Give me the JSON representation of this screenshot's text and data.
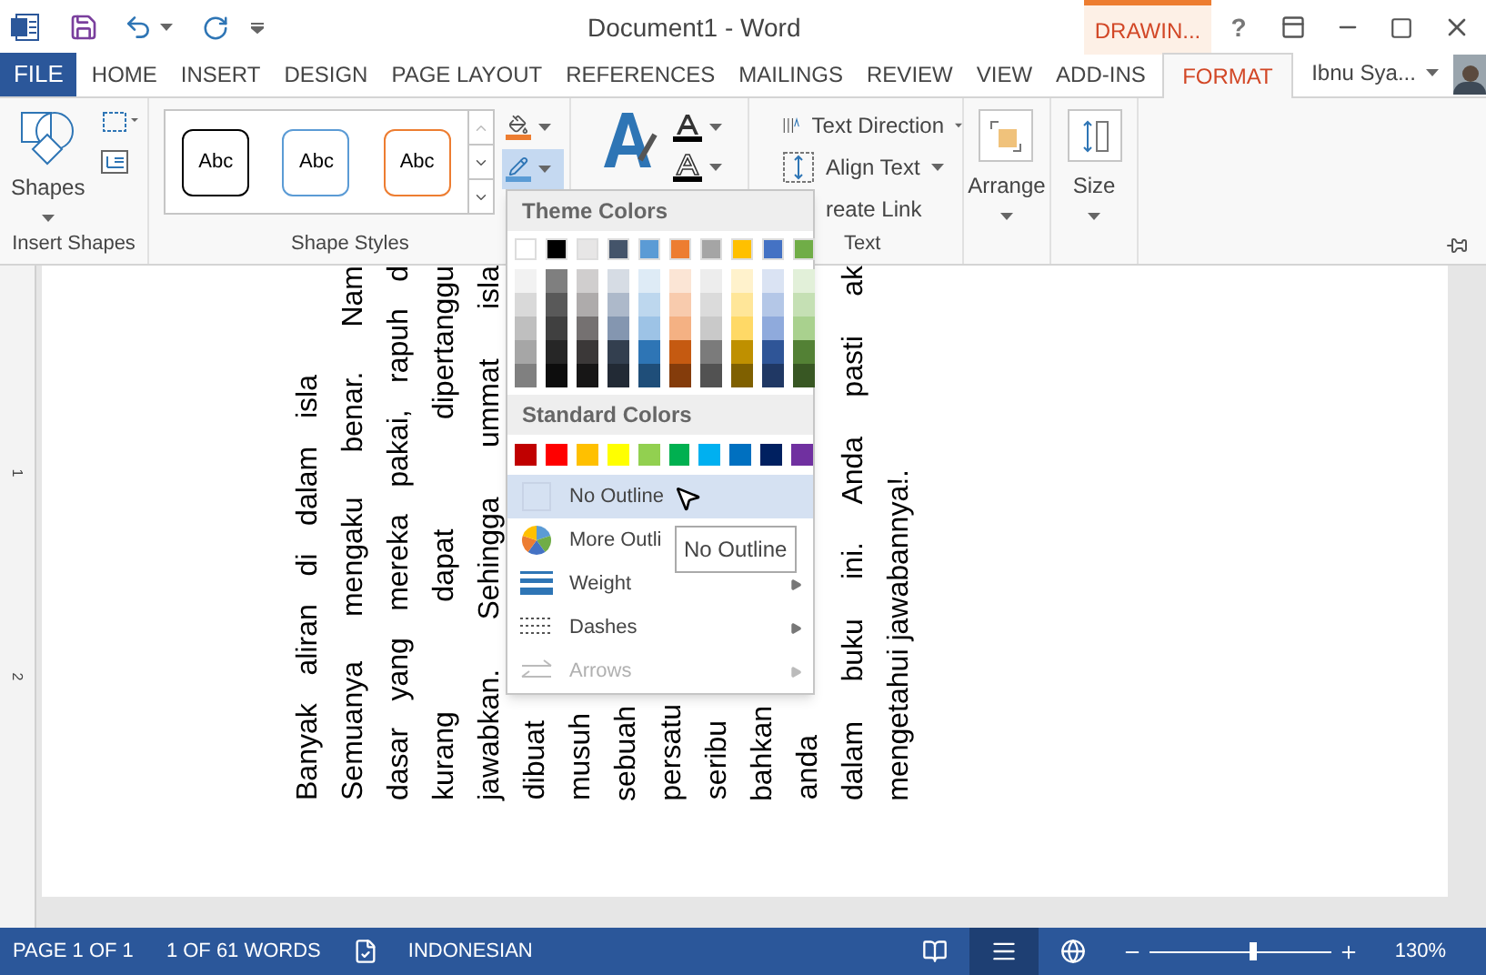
{
  "title_bar": {
    "title": "Document1 - Word",
    "contextual_tab": "DRAWIN...",
    "help": "?"
  },
  "tabs": [
    {
      "label": "FILE",
      "kind": "file",
      "selected": false
    },
    {
      "label": "HOME",
      "kind": "normal",
      "selected": false
    },
    {
      "label": "INSERT",
      "kind": "normal",
      "selected": false
    },
    {
      "label": "DESIGN",
      "kind": "normal",
      "selected": false
    },
    {
      "label": "PAGE LAYOUT",
      "kind": "normal",
      "selected": false
    },
    {
      "label": "REFERENCES",
      "kind": "normal",
      "selected": false
    },
    {
      "label": "MAILINGS",
      "kind": "normal",
      "selected": false
    },
    {
      "label": "REVIEW",
      "kind": "normal",
      "selected": false
    },
    {
      "label": "VIEW",
      "kind": "normal",
      "selected": false
    },
    {
      "label": "ADD-INS",
      "kind": "normal",
      "selected": false
    },
    {
      "label": "FORMAT",
      "kind": "contextual",
      "selected": true
    }
  ],
  "user": {
    "name": "Ibnu Sya..."
  },
  "ribbon": {
    "insert_shapes": {
      "shapes_label": "Shapes",
      "group_label": "Insert Shapes"
    },
    "shape_styles": {
      "styles": [
        {
          "label": "Abc",
          "color": "#000000"
        },
        {
          "label": "Abc",
          "color": "#5b9bd5"
        },
        {
          "label": "Abc",
          "color": "#ed7d31"
        }
      ],
      "outline_pressed": true,
      "group_label": "Shape Styles"
    },
    "text_group": {
      "items": [
        {
          "label": "Text Direction",
          "kind": "direction",
          "dropdown": true
        },
        {
          "label": "Align Text",
          "kind": "align",
          "dropdown": true
        },
        {
          "label": "reate Link",
          "kind": "link",
          "dropdown": false
        }
      ],
      "group_label": "Text"
    },
    "arrange": {
      "label": "Arrange"
    },
    "size": {
      "label": "Size"
    }
  },
  "outline_menu": {
    "theme_header": "Theme Colors",
    "theme_colors": [
      {
        "color": "#ffffff",
        "shades": [
          {
            "color": "#f2f2f2"
          },
          {
            "color": "#d9d9d9"
          },
          {
            "color": "#bfbfbf"
          },
          {
            "color": "#a6a6a6"
          },
          {
            "color": "#808080"
          }
        ]
      },
      {
        "color": "#000000",
        "shades": [
          {
            "color": "#7f7f7f"
          },
          {
            "color": "#595959"
          },
          {
            "color": "#404040"
          },
          {
            "color": "#262626"
          },
          {
            "color": "#0d0d0d"
          }
        ]
      },
      {
        "color": "#e7e6e6",
        "shades": [
          {
            "color": "#d0cece"
          },
          {
            "color": "#aeabab"
          },
          {
            "color": "#757171"
          },
          {
            "color": "#3b3838"
          },
          {
            "color": "#171616"
          }
        ]
      },
      {
        "color": "#44546a",
        "shades": [
          {
            "color": "#d6dce4"
          },
          {
            "color": "#adb9ca"
          },
          {
            "color": "#8496b0"
          },
          {
            "color": "#333f4f"
          },
          {
            "color": "#222a35"
          }
        ]
      },
      {
        "color": "#5b9bd5",
        "shades": [
          {
            "color": "#deebf6"
          },
          {
            "color": "#bdd7ee"
          },
          {
            "color": "#9dc3e6"
          },
          {
            "color": "#2e75b5"
          },
          {
            "color": "#1f4e79"
          }
        ]
      },
      {
        "color": "#ed7d31",
        "shades": [
          {
            "color": "#fbe5d5"
          },
          {
            "color": "#f8cbad"
          },
          {
            "color": "#f4b183"
          },
          {
            "color": "#c55a11"
          },
          {
            "color": "#843c0b"
          }
        ]
      },
      {
        "color": "#a5a5a5",
        "shades": [
          {
            "color": "#ededed"
          },
          {
            "color": "#dbdbdb"
          },
          {
            "color": "#c9c9c9"
          },
          {
            "color": "#7b7b7b"
          },
          {
            "color": "#525252"
          }
        ]
      },
      {
        "color": "#ffc000",
        "shades": [
          {
            "color": "#fff2cc"
          },
          {
            "color": "#ffe699"
          },
          {
            "color": "#ffd966"
          },
          {
            "color": "#bf9000"
          },
          {
            "color": "#7f6000"
          }
        ]
      },
      {
        "color": "#4472c4",
        "shades": [
          {
            "color": "#dae3f3"
          },
          {
            "color": "#b4c7e7"
          },
          {
            "color": "#8faadc"
          },
          {
            "color": "#2f5597"
          },
          {
            "color": "#203864"
          }
        ]
      },
      {
        "color": "#70ad47",
        "shades": [
          {
            "color": "#e2f0d9"
          },
          {
            "color": "#c5e0b4"
          },
          {
            "color": "#a9d18e"
          },
          {
            "color": "#538135"
          },
          {
            "color": "#385723"
          }
        ]
      }
    ],
    "standard_header": "Standard Colors",
    "standard_colors": [
      {
        "color": "#c00000"
      },
      {
        "color": "#ff0000"
      },
      {
        "color": "#ffc000"
      },
      {
        "color": "#ffff00"
      },
      {
        "color": "#92d050"
      },
      {
        "color": "#00b050"
      },
      {
        "color": "#00b0f0"
      },
      {
        "color": "#0070c0"
      },
      {
        "color": "#002060"
      },
      {
        "color": "#7030a0"
      }
    ],
    "items": [
      {
        "label": "No Outline",
        "kind": "none",
        "selected": true,
        "disabled": false,
        "submenu": false
      },
      {
        "label": "More Outli",
        "kind": "palette",
        "selected": false,
        "disabled": false,
        "submenu": false
      },
      {
        "label": "Weight",
        "kind": "weight",
        "selected": false,
        "disabled": false,
        "submenu": true
      },
      {
        "label": "Dashes",
        "kind": "dashes",
        "selected": false,
        "disabled": false,
        "submenu": true
      },
      {
        "label": "Arrows",
        "kind": "arrows",
        "selected": false,
        "disabled": true,
        "submenu": true
      }
    ]
  },
  "tooltip": "No Outline",
  "document": {
    "ruler_marks": [
      "1",
      "2"
    ],
    "columns": [
      {
        "text": "Banyak aliran di dalam isla",
        "kind": "justified"
      },
      {
        "text": "Semuanya mengaku benar. Nam",
        "kind": "justified"
      },
      {
        "text": "dasar yang mereka pakai, rapuh d",
        "kind": "justified"
      },
      {
        "text": "kurang dapat dipertanggu",
        "kind": "justified"
      },
      {
        "text": "jawabkan. Sehingga ummat isla",
        "kind": "justified"
      },
      {
        "text": "dibuat",
        "kind": "plain"
      },
      {
        "text": "musuh",
        "kind": "plain"
      },
      {
        "text": "sebuah",
        "kind": "plain"
      },
      {
        "text": "persatu",
        "kind": "plain"
      },
      {
        "text": "seribu",
        "kind": "plain"
      },
      {
        "text": "bahkan",
        "kind": "plain"
      },
      {
        "text": "anda",
        "kind": "plain"
      },
      {
        "text": "dalam buku ini. Anda pasti ak",
        "kind": "justified"
      },
      {
        "text": "mengetahui jawabannya!.",
        "kind": "plain"
      }
    ]
  },
  "status_bar": {
    "page": "PAGE 1 OF 1",
    "words": "1 OF 61 WORDS",
    "language": "INDONESIAN",
    "views": [
      {
        "kind": "read",
        "selected": false
      },
      {
        "kind": "print",
        "selected": true
      },
      {
        "kind": "web",
        "selected": false
      }
    ],
    "zoom": {
      "level": 0.55,
      "reading": "130%"
    }
  }
}
